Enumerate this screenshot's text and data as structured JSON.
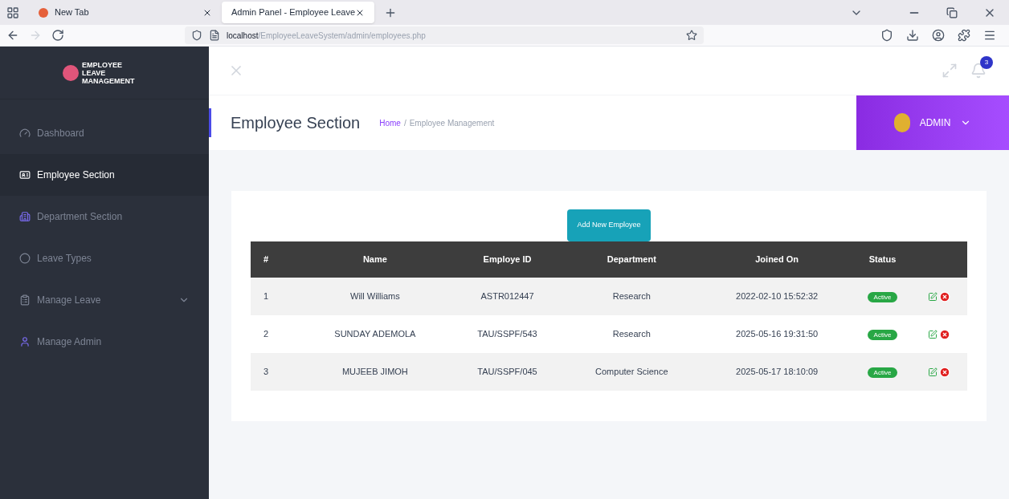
{
  "browser": {
    "tabs": [
      {
        "title": "New Tab",
        "selected": false
      },
      {
        "title": "Admin Panel - Employee Leave",
        "selected": true
      }
    ],
    "url_host": "localhost",
    "url_path": "/EmployeeLeaveSystem/admin/employees.php"
  },
  "sidebar": {
    "logo": "EMPLOYEE LEAVE MANAGEMENT",
    "items": [
      {
        "label": "Dashboard",
        "selected": false,
        "expandable": false
      },
      {
        "label": "Employee Section",
        "selected": true,
        "expandable": false
      },
      {
        "label": "Department Section",
        "selected": false,
        "expandable": false
      },
      {
        "label": "Leave Types",
        "selected": false,
        "expandable": false
      },
      {
        "label": "Manage Leave",
        "selected": false,
        "expandable": true
      },
      {
        "label": "Manage Admin",
        "selected": false,
        "expandable": false
      }
    ]
  },
  "topbar": {
    "notification_count": "3",
    "user": "ADMIN"
  },
  "header": {
    "title": "Employee Section",
    "breadcrumb": [
      "Home",
      "Employee Management"
    ],
    "breadcrumb_separator": "/"
  },
  "add_button": "Add New Employee",
  "table": {
    "columns": [
      "#",
      "Name",
      "Employe ID",
      "Department",
      "Joined On",
      "Status"
    ],
    "rows": [
      {
        "cells": [
          "1",
          "Will Williams",
          "ASTR012447",
          "Research",
          "2022-02-10 15:52:32"
        ],
        "status": "Active"
      },
      {
        "cells": [
          "2",
          "SUNDAY ADEMOLA",
          "TAU/SSPF/543",
          "Research",
          "2025-05-16 19:31:50"
        ],
        "status": "Active"
      },
      {
        "cells": [
          "3",
          "MUJEEB JIMOH",
          "TAU/SSPF/045",
          "Computer Science",
          "2025-05-17 18:10:09"
        ],
        "status": "Active"
      }
    ]
  }
}
